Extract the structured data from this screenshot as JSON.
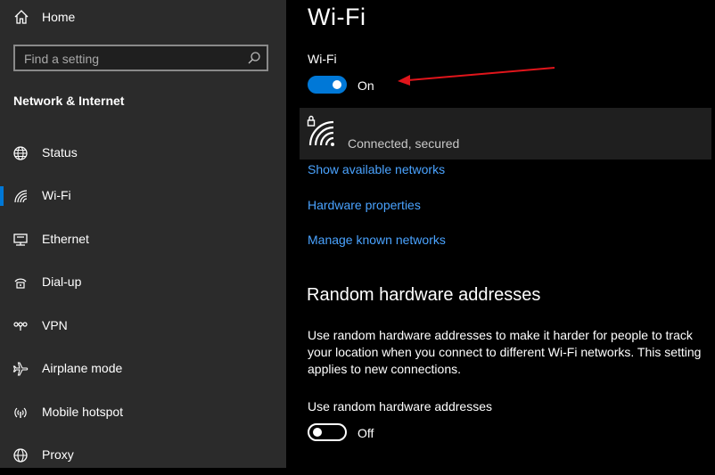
{
  "sidebar": {
    "home_label": "Home",
    "search_placeholder": "Find a setting",
    "section_title": "Network & Internet",
    "items": [
      {
        "label": "Status",
        "icon": "globe-icon",
        "selected": false
      },
      {
        "label": "Wi-Fi",
        "icon": "wifi-icon",
        "selected": true
      },
      {
        "label": "Ethernet",
        "icon": "ethernet-icon",
        "selected": false
      },
      {
        "label": "Dial-up",
        "icon": "dialup-icon",
        "selected": false
      },
      {
        "label": "VPN",
        "icon": "vpn-icon",
        "selected": false
      },
      {
        "label": "Airplane mode",
        "icon": "airplane-icon",
        "selected": false
      },
      {
        "label": "Mobile hotspot",
        "icon": "hotspot-icon",
        "selected": false
      },
      {
        "label": "Proxy",
        "icon": "globe-icon",
        "selected": false
      }
    ]
  },
  "main": {
    "title": "Wi-Fi",
    "wifi_toggle": {
      "label": "Wi-Fi",
      "state": "On",
      "on": true
    },
    "network": {
      "status": "Connected, secured",
      "icon": "wifi-secured-icon"
    },
    "links": {
      "show_networks": "Show available networks",
      "hardware_properties": "Hardware properties",
      "manage_networks": "Manage known networks"
    },
    "random_section": {
      "title": "Random hardware addresses",
      "description": "Use random hardware addresses to make it harder for people to track your location when you connect to different Wi-Fi networks. This setting applies to new connections.",
      "toggle_label": "Use random hardware addresses",
      "toggle_state": "Off",
      "on": false
    }
  },
  "colors": {
    "accent": "#0078d7",
    "link": "#4aa3ff",
    "sidebar_bg": "#2b2b2b",
    "main_bg": "#000000",
    "annotation_arrow": "#e0151b"
  }
}
